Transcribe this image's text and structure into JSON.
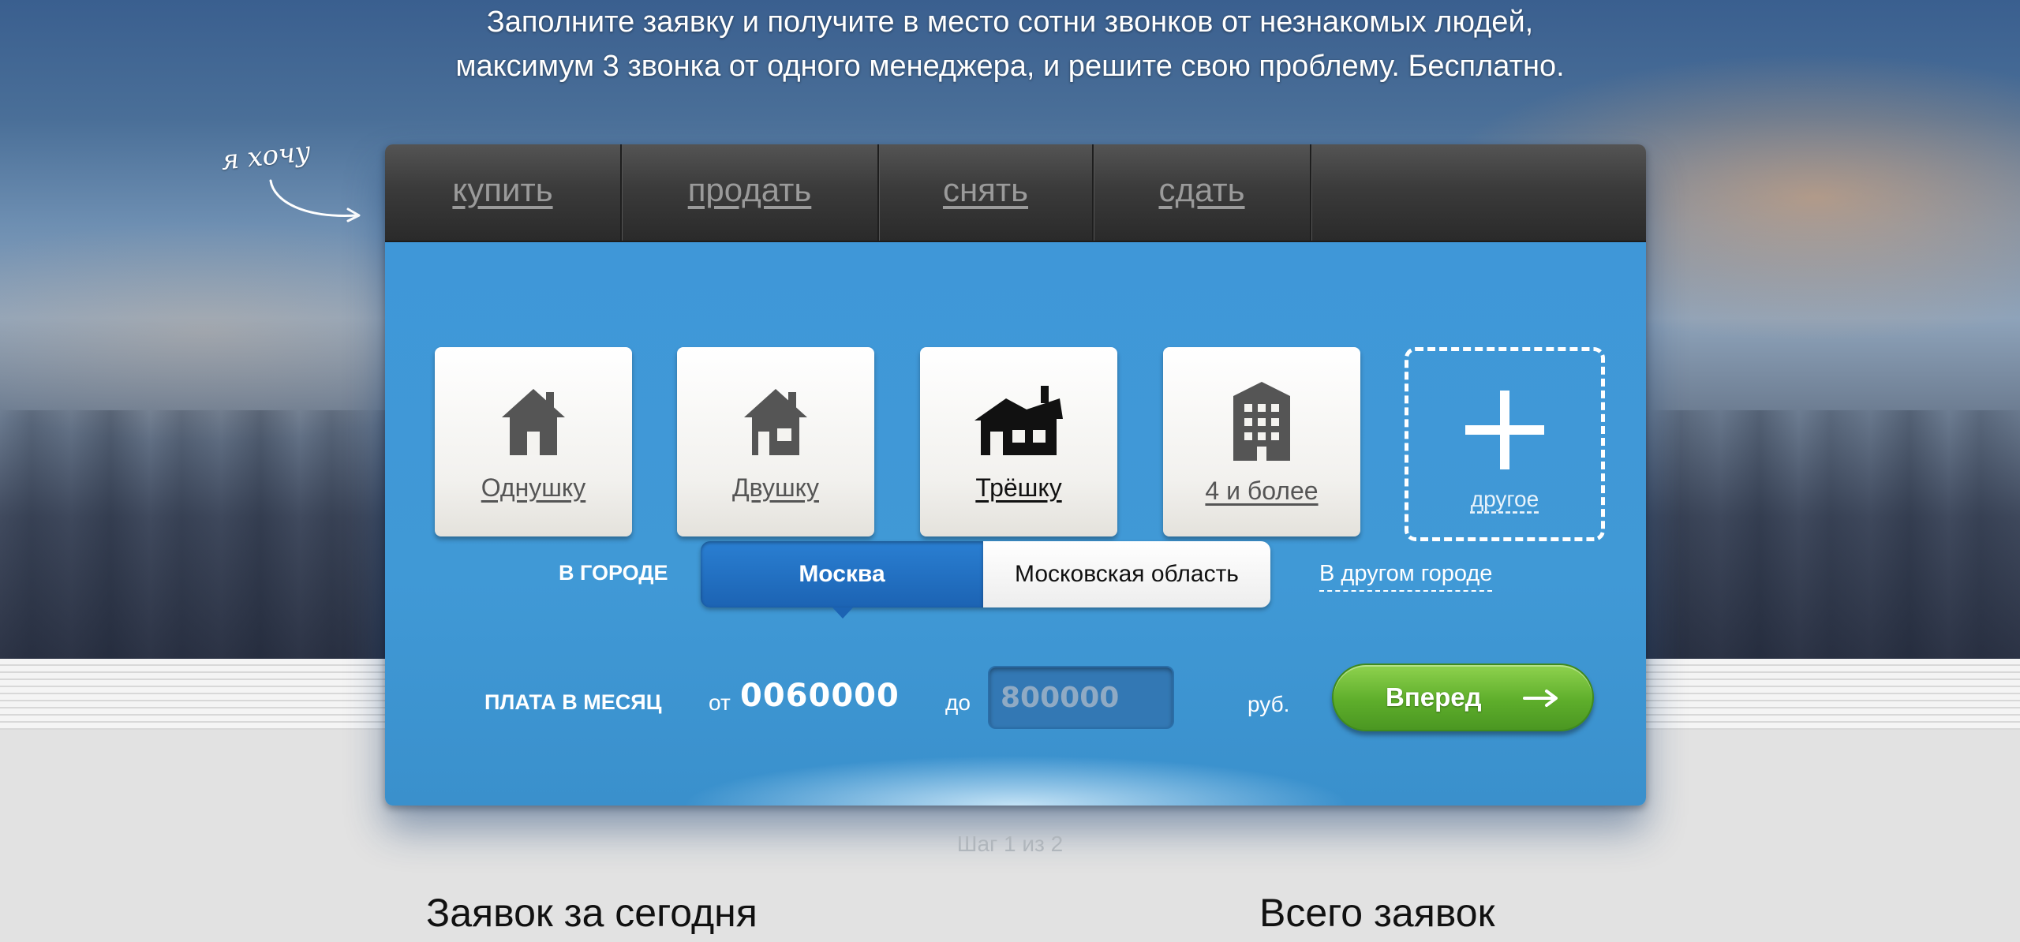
{
  "intro": {
    "line1": "Заполните заявку и получите в место сотни звонков от незнакомых людей,",
    "line2": "максимум 3 звонка от одного менеджера, и решите свою проблему. Бесплатно."
  },
  "want_note": "я хочу",
  "tabs": [
    "купить",
    "продать",
    "снять",
    "сдать"
  ],
  "property_types": [
    {
      "label": "Однушку",
      "icon": "house-small-icon"
    },
    {
      "label": "Двушку",
      "icon": "house-two-icon"
    },
    {
      "label": "Трёшку",
      "icon": "house-three-icon"
    },
    {
      "label": "4 и более",
      "icon": "building-icon"
    }
  ],
  "other_card": {
    "label": "другое",
    "icon": "plus-icon"
  },
  "city": {
    "label": "В ГОРОДЕ",
    "options": [
      "Москва",
      "Московская область"
    ],
    "selected": "Москва",
    "other_link": "В другом городе"
  },
  "fee": {
    "label": "ПЛАТА В МЕСЯЦ",
    "from_label": "от",
    "from_value": "0060000",
    "to_label": "до",
    "to_placeholder": "800000",
    "currency": "руб."
  },
  "next_button": "Вперед",
  "step": "Шаг 1 из 2",
  "stats": {
    "today_label": "Заявок за сегодня",
    "total_label": "Всего заявок"
  },
  "colors": {
    "panel_blue": "#3f97d8",
    "tab_bar": "#3b3b3b",
    "accent_green": "#5eae2b",
    "active_segment": "#1c63b3"
  }
}
